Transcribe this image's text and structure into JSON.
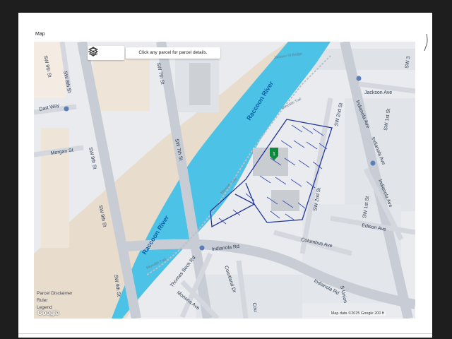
{
  "header": {
    "map_title": "Map"
  },
  "toolbar": {
    "layers_icon": "layers-icon",
    "locate_icon": "locate-icon"
  },
  "hint": {
    "text": "Click any parcel for parcel details."
  },
  "streets": {
    "sw_8th": "SW 8th St",
    "sw_9th": "SW 9th St",
    "sw_7th": "SW 7th St",
    "sw_2nd": "SW 2nd St",
    "sw_1st": "SW 1st St",
    "sw_3rd": "SW 3",
    "dart_way": "Dart Way",
    "morgan": "Morgan St",
    "jackson": "Jackson Ave",
    "indianola_ave": "Indianola Ave",
    "edison": "Edison Ave",
    "columbus": "Columbus Ave",
    "indianola_rd": "Indianola Rd",
    "thomas_beck": "Thomas Beck Rd",
    "courtland": "Courtland Dr",
    "monona": "Monona Ave",
    "s_union": "S Union",
    "cou": "Cou"
  },
  "river": {
    "label": "Raccoon River"
  },
  "trail": {
    "label": "Meredith Trail",
    "bridge_label": "Jackson St Bridge"
  },
  "marker": {
    "label": "1",
    "color": "#0f8a3c"
  },
  "legend": {
    "disclaimer": "Parcel Disclaimer",
    "ruler": "Ruler",
    "legend": "Legend"
  },
  "footer": {
    "google": "Google",
    "attribution": "Map data ©2025 Google  200 ft"
  },
  "colors": {
    "river": "#4cc2e6",
    "parcel_outline": "#23379b",
    "floodplain": "#e8dccd",
    "road": "#c8ccd4"
  }
}
